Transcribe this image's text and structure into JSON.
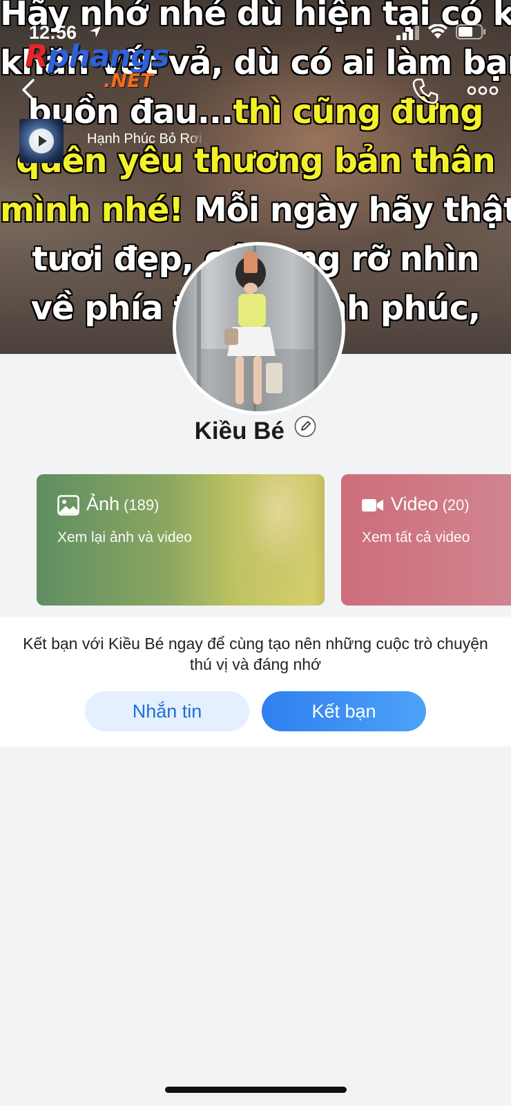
{
  "status_bar": {
    "time": "12:56"
  },
  "watermark": {
    "brand": "Rphangs",
    "suffix": ".NET"
  },
  "cover": {
    "lines": [
      [
        {
          "t": "Hãy nhớ nhé dù hiện tại có khó",
          "c": "white"
        }
      ],
      [
        {
          "t": "khăn vất vả, dù có ai làm bạn",
          "c": "white"
        }
      ],
      [
        {
          "t": "buồn đau...",
          "c": "white"
        },
        {
          "t": "thì cũng đừng",
          "c": "yellow"
        }
      ],
      [
        {
          "t": "quên yêu thương bản thân",
          "c": "yellow"
        }
      ],
      [
        {
          "t": "mình nhé!",
          "c": "yellow"
        },
        {
          "t": " Mỗi ngày hãy thật",
          "c": "white"
        }
      ],
      [
        {
          "t": "tươi đẹp, cứ rạng rỡ nhìn",
          "c": "white"
        }
      ],
      [
        {
          "t": "về phía trước hạnh phúc,",
          "c": "white"
        }
      ]
    ]
  },
  "music": {
    "title": "Hạnh Phúc Bỏ Rơi Em"
  },
  "profile": {
    "name": "Kiều Bé"
  },
  "cards": {
    "photos": {
      "title": "Ảnh",
      "count": "(189)",
      "subtitle": "Xem lại ảnh và video"
    },
    "videos": {
      "title": "Video",
      "count": "(20)",
      "subtitle": "Xem tất cả video"
    }
  },
  "friend_prompt": {
    "text": "Kết bạn với Kiều Bé ngay để cùng tạo nên những cuộc trò chuyện thú vị và đáng nhớ",
    "message_label": "Nhắn tin",
    "add_friend_label": "Kết bạn"
  },
  "colors": {
    "primary": "#2f7fef",
    "message_button_bg": "#e4f0fd",
    "photo_card": "#6f9a62",
    "video_card": "#cd6d7b"
  },
  "icons": [
    "back-arrow-icon",
    "phone-icon",
    "more-icon",
    "play-icon",
    "edit-icon",
    "image-icon",
    "video-camera-icon"
  ]
}
